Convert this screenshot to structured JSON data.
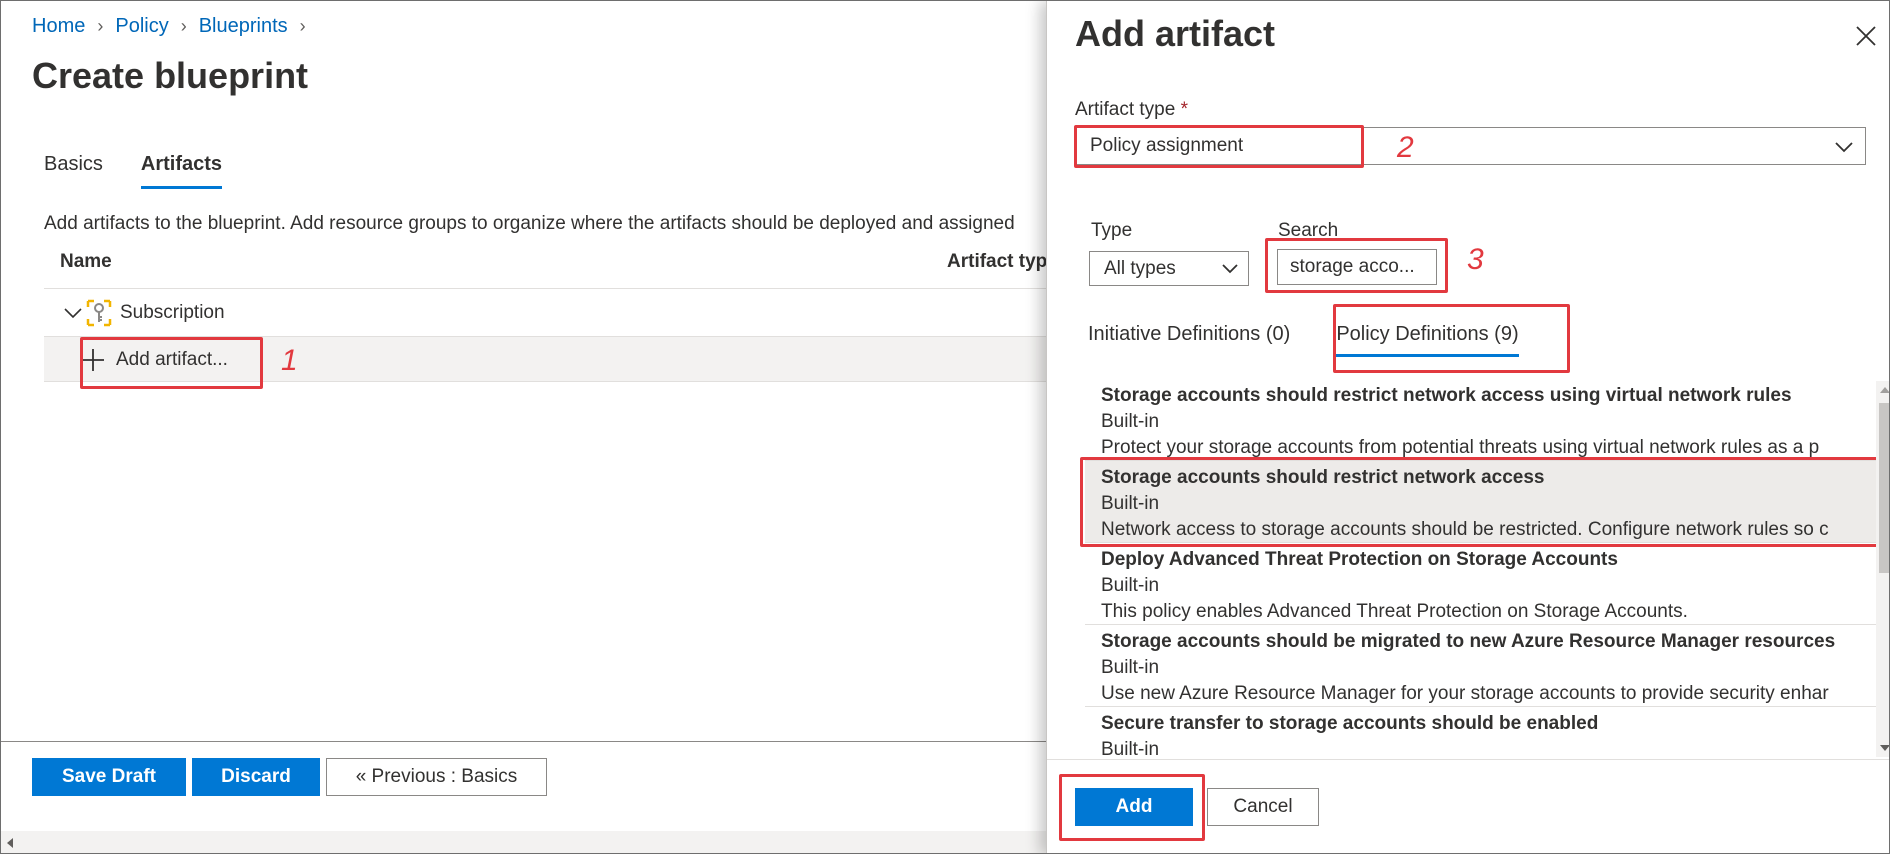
{
  "breadcrumb": {
    "items": [
      "Home",
      "Policy",
      "Blueprints"
    ]
  },
  "page": {
    "title": "Create blueprint",
    "tabs": [
      "Basics",
      "Artifacts"
    ],
    "active_tab": "Artifacts",
    "description": "Add artifacts to the blueprint. Add resource groups to organize where the artifacts should be deployed and assigned"
  },
  "grid": {
    "columns": [
      "Name",
      "Artifact typ"
    ],
    "subscription_label": "Subscription",
    "add_artifact_label": "Add artifact..."
  },
  "footer": {
    "save_draft": "Save Draft",
    "discard": "Discard",
    "previous": "« Previous : Basics"
  },
  "callouts": [
    "1",
    "2",
    "3"
  ],
  "blade": {
    "title": "Add artifact",
    "artifact_type_label": "Artifact type",
    "required_marker": "*",
    "artifact_type_value": "Policy assignment",
    "type_label": "Type",
    "type_value": "All types",
    "search_label": "Search",
    "search_value": "storage acco...",
    "tabs": [
      {
        "label": "Initiative Definitions (0)",
        "active": false
      },
      {
        "label": "Policy Definitions (9)",
        "active": true
      }
    ],
    "definitions": [
      {
        "title": "Storage accounts should restrict network access using virtual network rules",
        "kind": "Built-in",
        "description": "Protect your storage accounts from potential threats using virtual network rules as a p"
      },
      {
        "title": "Storage accounts should restrict network access",
        "kind": "Built-in",
        "description": "Network access to storage accounts should be restricted. Configure network rules so c",
        "selected": true
      },
      {
        "title": "Deploy Advanced Threat Protection on Storage Accounts",
        "kind": "Built-in",
        "description": "This policy enables Advanced Threat Protection on Storage Accounts."
      },
      {
        "title": "Storage accounts should be migrated to new Azure Resource Manager resources",
        "kind": "Built-in",
        "description": "Use new Azure Resource Manager for your storage accounts to provide security enhar"
      },
      {
        "title": "Secure transfer to storage accounts should be enabled",
        "kind": "Built-in",
        "description": ""
      }
    ],
    "add_button": "Add",
    "cancel_button": "Cancel"
  },
  "colors": {
    "accent": "#0078d4",
    "link": "#0067b8",
    "callout_red": "#e2393f",
    "key_icon_yellow": "#f2b500"
  },
  "icons": [
    "chevron-right-icon",
    "chevron-down-icon",
    "key-icon",
    "plus-icon",
    "close-icon"
  ]
}
